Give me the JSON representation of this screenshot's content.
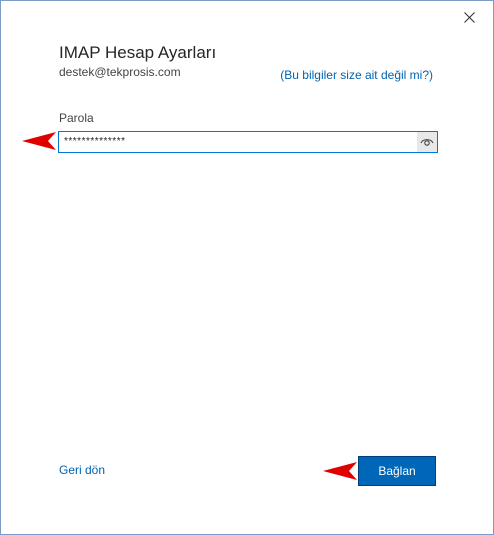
{
  "dialog": {
    "title": "IMAP Hesap Ayarları",
    "account_email": "destek@tekprosis.com",
    "not_yours_link": "(Bu bilgiler size ait değil mi?)",
    "close_icon": "close-icon"
  },
  "password_field": {
    "label": "Parola",
    "value": "**************",
    "reveal_icon": "eye-icon"
  },
  "footer": {
    "back_link": "Geri dön",
    "connect_button": "Bağlan"
  },
  "colors": {
    "accent": "#0067b8",
    "link": "#0063b1",
    "annotation_arrow": "#e00000"
  }
}
